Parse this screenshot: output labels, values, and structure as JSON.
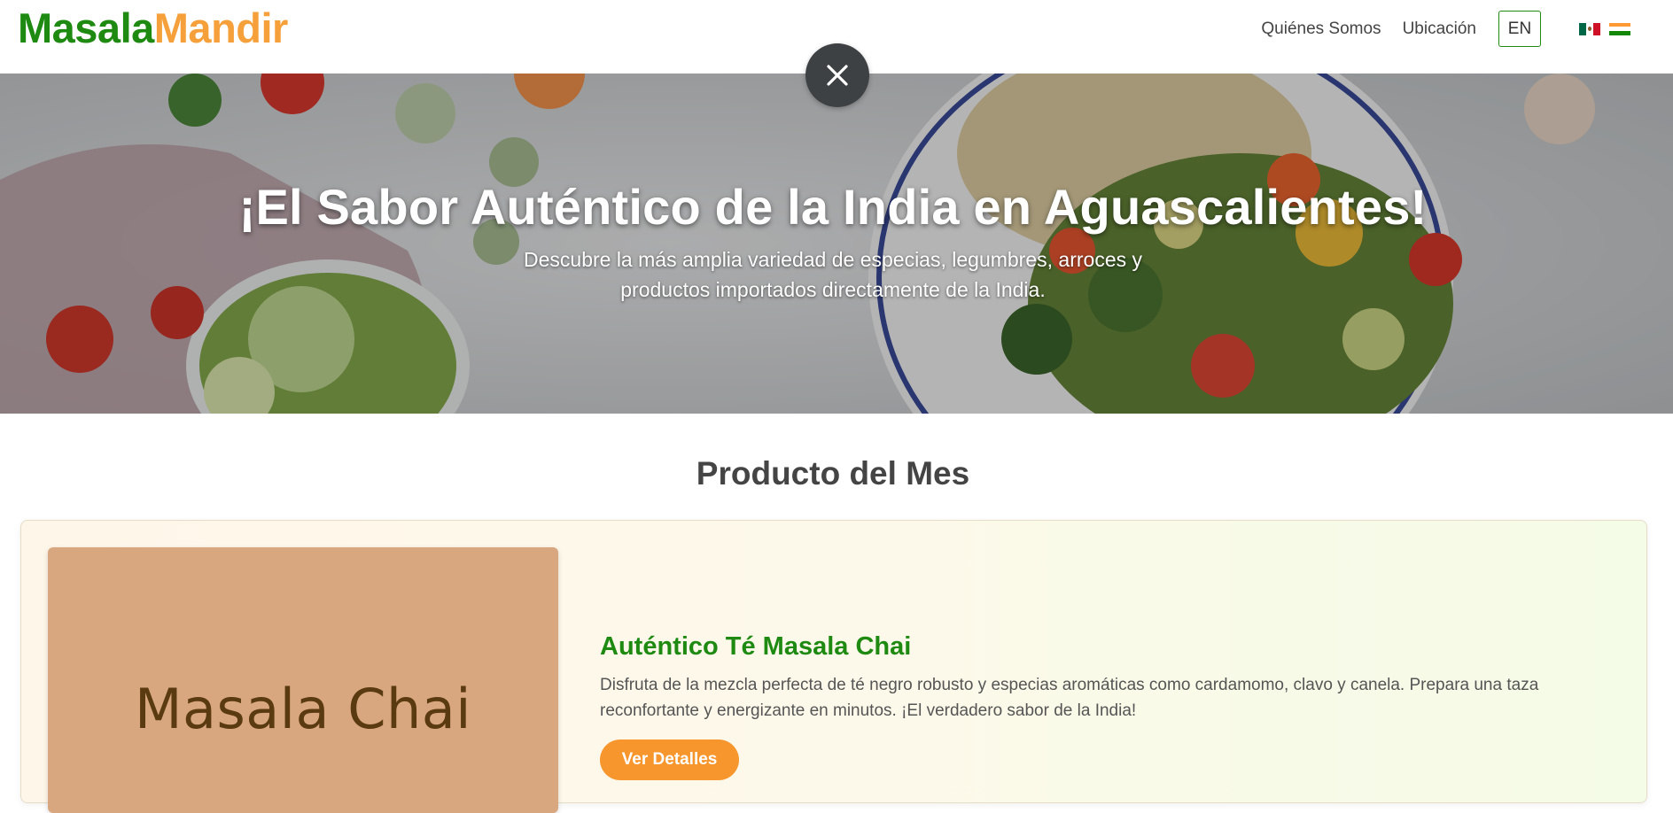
{
  "header": {
    "logo_part1": "Masala",
    "logo_part2": "Mandir",
    "nav": [
      {
        "label": "Quiénes Somos"
      },
      {
        "label": "Ubicación"
      }
    ],
    "language_button": "EN",
    "flags": [
      {
        "icon": "mexico-flag-icon",
        "colors": [
          "#006847",
          "#ffffff",
          "#ce1126"
        ]
      },
      {
        "icon": "india-flag-icon",
        "colors": [
          "#ff9933",
          "#ffffff",
          "#138808"
        ]
      }
    ]
  },
  "popup": {
    "close_icon": "close-icon"
  },
  "hero": {
    "title": "¡El Sabor Auténtico de la India en Aguascalientes!",
    "subtitle": "Descubre la más amplia variedad de especias, legumbres, arroces y productos importados directamente de la India."
  },
  "featured": {
    "section_title": "Producto del Mes",
    "image_text": "Masala Chai",
    "product_name": "Auténtico Té Masala Chai",
    "description": "Disfruta de la mezcla perfecta de té negro robusto y especias aromáticas como cardamomo, clavo y canela. Prepara una taza reconfortante y energizante en minutos. ¡El verdadero sabor de la India!",
    "button_label": "Ver Detalles"
  },
  "colors": {
    "brand_green": "#1e8a12",
    "brand_orange": "#f5a03a",
    "button_orange": "#f7962c"
  }
}
